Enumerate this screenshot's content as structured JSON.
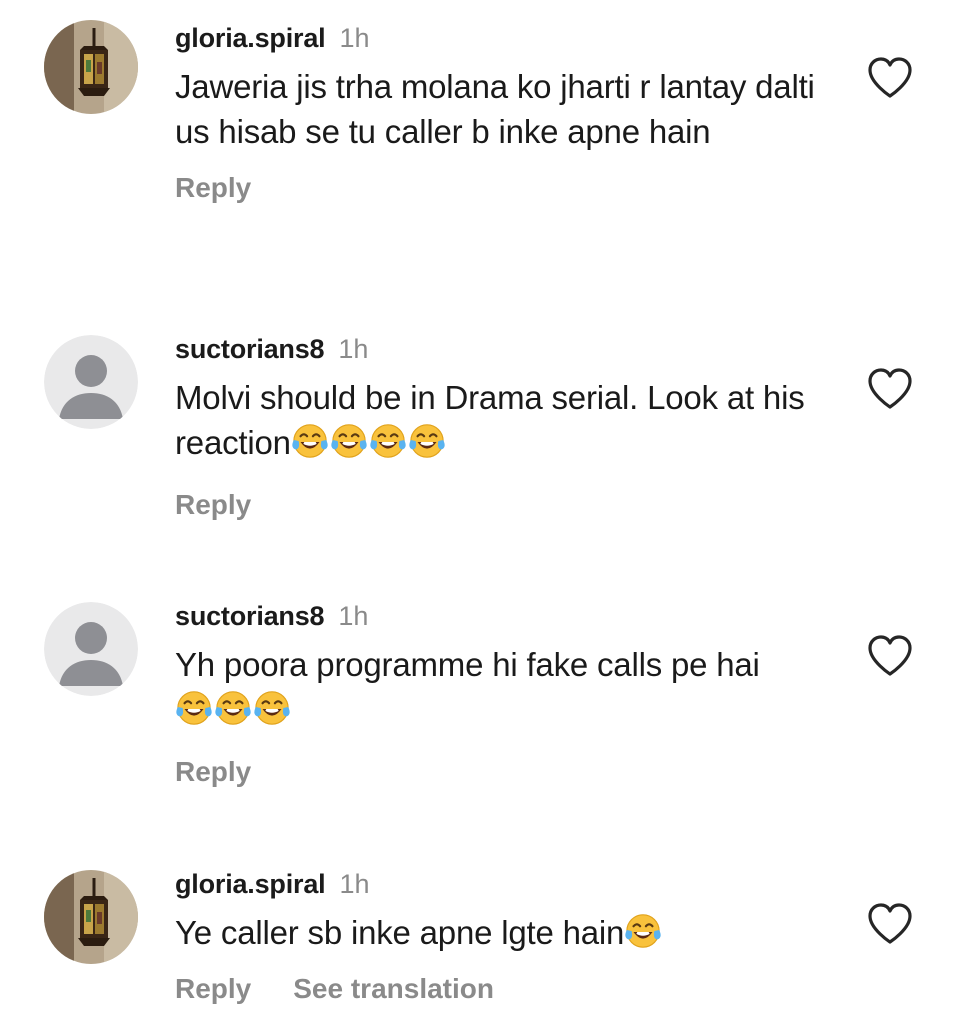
{
  "comments": [
    {
      "username": "gloria.spiral",
      "time": "1h",
      "text": "Jaweria jis trha molana ko jharti r lantay dalti us hisab se tu caller b inke apne hain",
      "emoji_count": 0,
      "avatar": "lantern-avatar",
      "reply_label": "Reply",
      "like_icon": "heart-outline-icon"
    },
    {
      "username": "suctorians8",
      "time": "1h",
      "text": "Molvi should be in Drama serial. Look at his reaction",
      "emoji_count": 4,
      "emoji": "😂",
      "avatar": "default-user-avatar",
      "reply_label": "Reply",
      "like_icon": "heart-outline-icon"
    },
    {
      "username": "suctorians8",
      "time": "1h",
      "text": "Yh poora programme hi fake calls pe hai",
      "emoji_count": 3,
      "emoji": "😂",
      "avatar": "default-user-avatar",
      "reply_label": "Reply",
      "like_icon": "heart-outline-icon"
    },
    {
      "username": "gloria.spiral",
      "time": "1h",
      "text": "Ye caller sb inke apne lgte hain",
      "emoji_count": 1,
      "emoji": "😂",
      "avatar": "lantern-avatar",
      "reply_label": "Reply",
      "see_translation_label": "See translation",
      "like_icon": "heart-outline-icon"
    }
  ],
  "colors": {
    "username": "#1b1b1b",
    "secondary_text": "#8a8a8a",
    "body_text": "#1a1a1a",
    "default_avatar_bg": "#e9e9ea",
    "default_avatar_fg": "#8e8f94",
    "lantern_avatar_bg": "#b5a48b"
  }
}
